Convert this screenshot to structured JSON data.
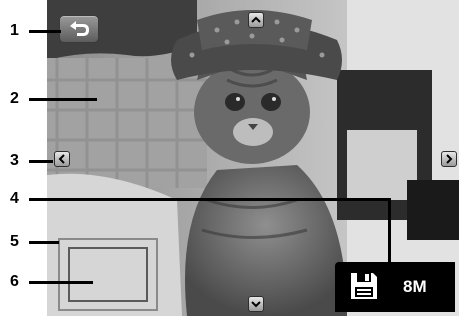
{
  "callouts": [
    {
      "number": "1"
    },
    {
      "number": "2"
    },
    {
      "number": "3"
    },
    {
      "number": "4"
    },
    {
      "number": "5"
    },
    {
      "number": "6"
    }
  ],
  "screen": {
    "back_icon": "return-arrow-icon",
    "up_icon": "chevron-up-icon",
    "down_icon": "chevron-down-icon",
    "left_icon": "chevron-left-icon",
    "right_icon": "chevron-right-icon",
    "resolution_icon": "floppy-disk-icon",
    "resolution_label": "8M"
  }
}
